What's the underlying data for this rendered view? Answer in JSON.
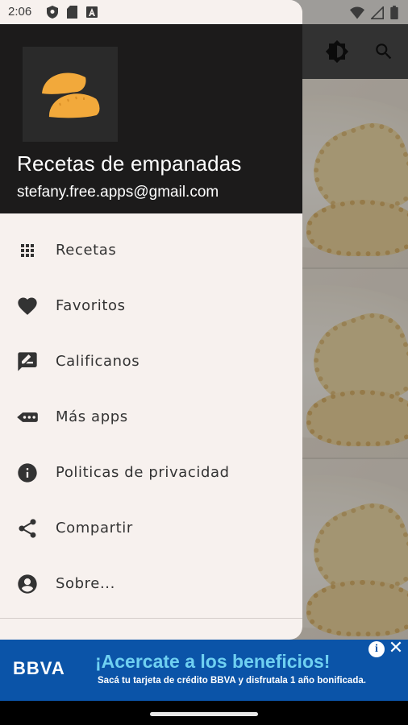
{
  "status_bar": {
    "time": "2:06",
    "left_icons": [
      "shield-icon",
      "sim-card-icon",
      "font-a-icon"
    ],
    "right_icons": [
      "wifi-icon",
      "signal-icon",
      "battery-icon"
    ]
  },
  "background_app": {
    "toolbar_icons": [
      "brightness-icon",
      "search-icon"
    ]
  },
  "drawer": {
    "header": {
      "logo_icon": "empanada-logo",
      "title": "Recetas de empanadas",
      "email": "stefany.free.apps@gmail.com"
    },
    "items": [
      {
        "label": "Recetas",
        "icon": "grid-icon"
      },
      {
        "label": "Favoritos",
        "icon": "heart-icon"
      },
      {
        "label": "Calificanos",
        "icon": "rate-review-icon"
      },
      {
        "label": "Más apps",
        "icon": "more-apps-icon"
      },
      {
        "label": "Politicas de privacidad",
        "icon": "info-icon"
      },
      {
        "label": "Compartir",
        "icon": "share-icon"
      },
      {
        "label": "Sobre...",
        "icon": "account-circle-icon"
      }
    ]
  },
  "ad": {
    "brand": "BBVA",
    "headline": "¡Acercate a los beneficios!",
    "subline": "Sacá tu tarjeta de crédito BBVA y disfrutala 1 año bonificada.",
    "info_label": "i",
    "close_label": "✕"
  },
  "colors": {
    "drawer_bg": "#f7f1ee",
    "header_bg": "#1c1b1b",
    "ad_bg": "#0b54a8",
    "ad_headline": "#6fd0f1",
    "logo_orange": "#f2a93b",
    "icon_dark": "#333333"
  }
}
